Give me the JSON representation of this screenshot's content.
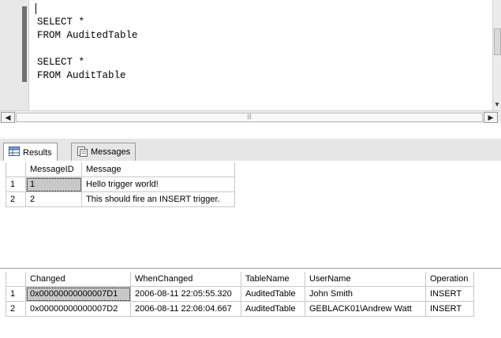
{
  "editor": {
    "lines": [
      "SELECT *",
      "FROM AuditedTable",
      "",
      "SELECT *",
      "FROM AuditTable"
    ],
    "scroll_thumb_glyph": "|||"
  },
  "tabs": [
    {
      "label": "Results",
      "icon": "grid-icon"
    },
    {
      "label": "Messages",
      "icon": "messages-icon"
    }
  ],
  "result1": {
    "columns": [
      "MessageID",
      "Message"
    ],
    "rows": [
      {
        "rownum": "1",
        "MessageID": "1",
        "Message": "Hello trigger world!"
      },
      {
        "rownum": "2",
        "MessageID": "2",
        "Message": "This should fire an INSERT trigger."
      }
    ]
  },
  "result2": {
    "columns": [
      "Changed",
      "WhenChanged",
      "TableName",
      "UserName",
      "Operation"
    ],
    "rows": [
      {
        "rownum": "1",
        "Changed": "0x00000000000007D1",
        "WhenChanged": "2006-08-11 22:05:55.320",
        "TableName": "AuditedTable",
        "UserName": "John Smith",
        "Operation": "INSERT"
      },
      {
        "rownum": "2",
        "Changed": "0x00000000000007D2",
        "WhenChanged": "2006-08-11 22:06:04.667",
        "TableName": "AuditedTable",
        "UserName": "GEBLACK01\\Andrew Watt",
        "Operation": "INSERT"
      }
    ]
  }
}
